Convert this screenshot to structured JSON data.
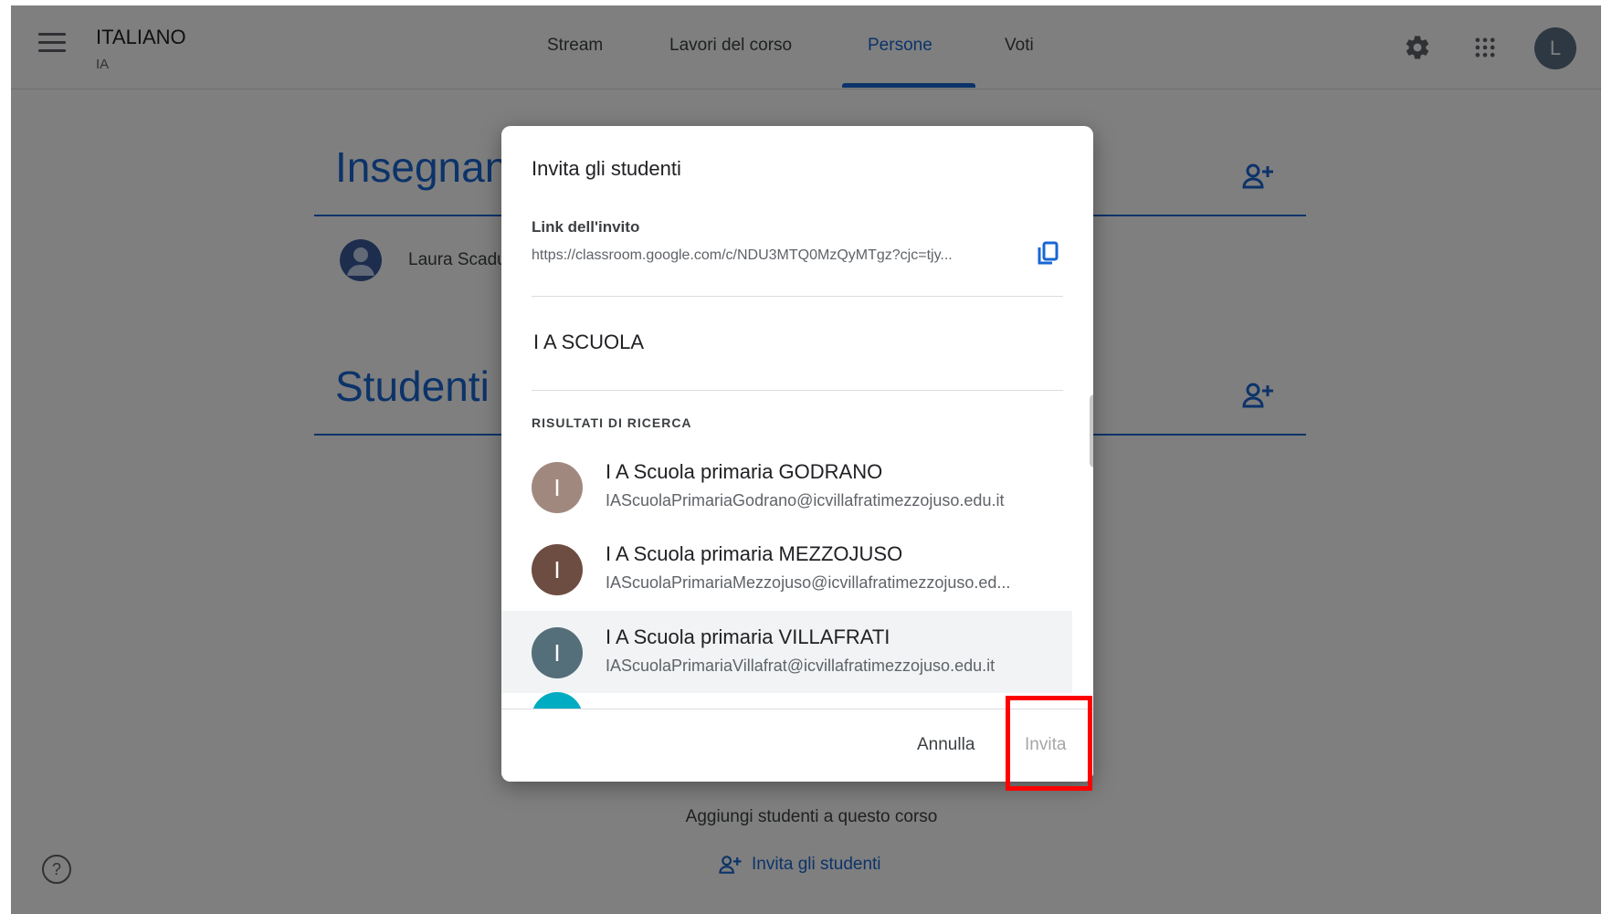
{
  "header": {
    "course_title": "ITALIANO",
    "course_subtitle": "IA",
    "tabs": [
      {
        "label": "Stream",
        "active": false
      },
      {
        "label": "Lavori del corso",
        "active": false
      },
      {
        "label": "Persone",
        "active": true
      },
      {
        "label": "Voti",
        "active": false
      }
    ],
    "icons": [
      "menu-icon",
      "settings-icon",
      "apps-icon"
    ],
    "user_initial": "L"
  },
  "people": {
    "teachers_title": "Insegnanti",
    "teacher_name": "Laura Scaduto",
    "students_title": "Studenti",
    "empty_text": "Aggiungi studenti a questo corso",
    "invite_link_label": "Invita gli studenti"
  },
  "dialog": {
    "title": "Invita gli studenti",
    "link_label": "Link dell'invito",
    "link_url": "https://classroom.google.com/c/NDU3MTQ0MzQyMTgz?cjc=tjy...",
    "search_value": "I A SCUOLA",
    "results_label": "RISULTATI DI RICERCA",
    "results": [
      {
        "initial": "I",
        "name": "I A Scuola primaria GODRANO",
        "email": "IAScuolaPrimariaGodrano@icvillafratimezzojuso.edu.it",
        "color": "#a1887f",
        "selected": false
      },
      {
        "initial": "I",
        "name": "I A Scuola primaria MEZZOJUSO",
        "email": "IAScuolaPrimariaMezzojuso@icvillafratimezzojuso.ed...",
        "color": "#6d4c41",
        "selected": false
      },
      {
        "initial": "I",
        "name": "I A Scuola primaria VILLAFRATI",
        "email": "IAScuolaPrimariaVillafrat@icvillafratimezzojuso.edu.it",
        "color": "#546e7a",
        "selected": true
      }
    ],
    "cancel_label": "Annulla",
    "invite_label": "Invita"
  },
  "colors": {
    "accent": "#1967d2",
    "highlight": "#ff0000"
  }
}
